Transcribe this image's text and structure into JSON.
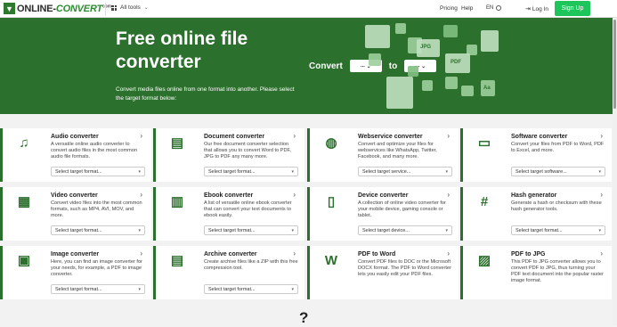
{
  "nav": {
    "logo_left": "ONLINE-",
    "logo_accent": "CONVERT",
    "logo_sup": "com",
    "all_tools": "All tools",
    "pricing": "Pricing",
    "help": "Help",
    "lang": "EN",
    "login": "Log In",
    "signup": "Sign Up"
  },
  "hero": {
    "title": "Free online file converter",
    "subtitle": "Convert media files online from one format into another. Please select the target format below:",
    "convert_label": "Convert",
    "to_label": "to",
    "from_value": "...",
    "to_value": "...",
    "icon_labels": [
      "JPG",
      "PDF",
      "Aa"
    ]
  },
  "cards": [
    {
      "title": "Audio converter",
      "desc": "A versatile online audio converter to convert audio files in the most common audio file formats.",
      "select": "Select target format...",
      "icon": "music-note-icon",
      "glyph": "♫"
    },
    {
      "title": "Document converter",
      "desc": "Our free document converter selection that allows you to convert Word to PDF, JPG to PDF any many more.",
      "select": "Select target format...",
      "icon": "document-icon",
      "glyph": "▤"
    },
    {
      "title": "Webservice converter",
      "desc": "Convert and optimize your files for webservices like WhatsApp, Twitter, Facebook, and many more.",
      "select": "Select target service...",
      "icon": "globe-icon",
      "glyph": "◍"
    },
    {
      "title": "Software converter",
      "desc": "Convert your files from PDF to Word, PDF to Excel, and more.",
      "select": "Select target software...",
      "icon": "monitor-icon",
      "glyph": "▭"
    },
    {
      "title": "Video converter",
      "desc": "Convert video files into the most common formats, such as MP4, AVI, MOV, and more.",
      "select": "Select target format...",
      "icon": "film-icon",
      "glyph": "▦"
    },
    {
      "title": "Ebook converter",
      "desc": "A list of versatile online ebook converter that can convert your text documents to ebook easily.",
      "select": "Select target format...",
      "icon": "books-icon",
      "glyph": "▥"
    },
    {
      "title": "Device converter",
      "desc": "A collection of online video converter for your mobile device, gaming console or tablet.",
      "select": "Select target device...",
      "icon": "tablet-icon",
      "glyph": "▯"
    },
    {
      "title": "Hash generator",
      "desc": "Generate a hash or checksum with these hash generator tools.",
      "select": "Select target format...",
      "icon": "hash-icon",
      "glyph": "#"
    },
    {
      "title": "Image converter",
      "desc": "Here, you can find an image converter for your needs, for example, a PDF to image converter.",
      "select": "Select target format...",
      "icon": "image-icon",
      "glyph": "▣"
    },
    {
      "title": "Archive converter",
      "desc": "Create archive files like a ZIP with this free compression tool.",
      "select": "Select target format...",
      "icon": "archive-icon",
      "glyph": "▤"
    },
    {
      "title": "PDF to Word",
      "desc": "Convert PDF files to DOC or the Microsoft DOCX format. The PDF to Word converter lets you easily edit your PDF files.",
      "select": "",
      "icon": "word-file-icon",
      "glyph": "W"
    },
    {
      "title": "PDF to JPG",
      "desc": "This PDF to JPG converter allows you to convert PDF to JPG, thus turning your PDF text document into the popular raster image format.",
      "select": "",
      "icon": "jpg-file-icon",
      "glyph": "▨"
    }
  ],
  "bottom_mark": "?"
}
